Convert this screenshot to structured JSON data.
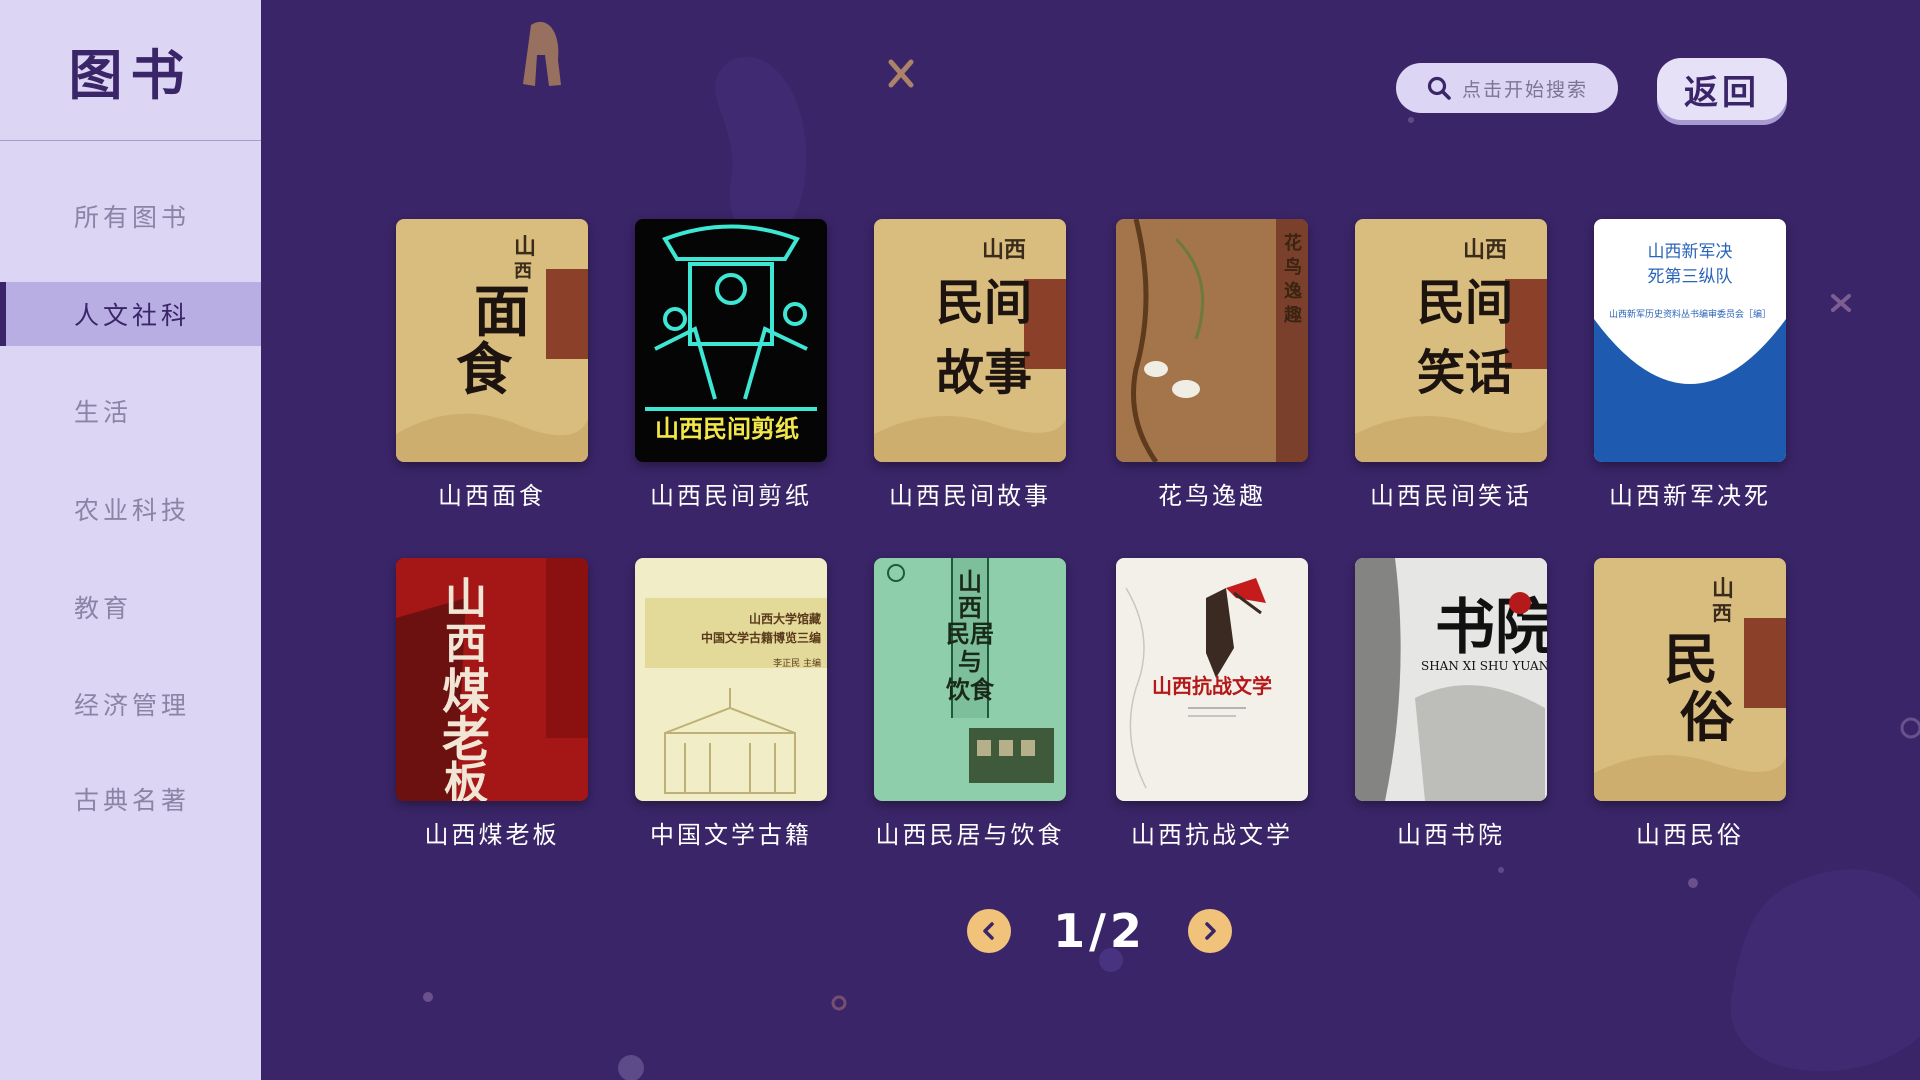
{
  "sidebar": {
    "title": "图书",
    "items": [
      {
        "label": "所有图书"
      },
      {
        "label": "人文社科"
      },
      {
        "label": "生活"
      },
      {
        "label": "农业科技"
      },
      {
        "label": "教育"
      },
      {
        "label": "经济管理"
      },
      {
        "label": "古典名著"
      }
    ],
    "active_index": 1
  },
  "header": {
    "search_placeholder": "点击开始搜索",
    "back_label": "返回"
  },
  "books": [
    {
      "title": "山西面食",
      "cover": {
        "bg": "#d9bd7f",
        "text": "山西面食"
      }
    },
    {
      "title": "山西民间剪纸",
      "cover": {
        "bg": "#050505",
        "text": "山西民间剪纸"
      }
    },
    {
      "title": "山西民间故事",
      "cover": {
        "bg": "#d9bd7f",
        "text": "山西民间故事"
      }
    },
    {
      "title": "花鸟逸趣",
      "cover": {
        "bg": "#9a6a40",
        "text": "花鸟逸趣"
      }
    },
    {
      "title": "山西民间笑话",
      "cover": {
        "bg": "#d9bd7f",
        "text": "山西民间笑话"
      }
    },
    {
      "title": "山西新军决死",
      "cover": {
        "bg": "#ffffff",
        "text": "山西新军决死第三纵队",
        "subtext": "山西新军历史资料丛书编审委员会［编］"
      }
    },
    {
      "title": "山西煤老板",
      "cover": {
        "bg": "#b41a1a",
        "text": "山西煤老板"
      }
    },
    {
      "title": "中国文学古籍",
      "cover": {
        "bg": "#f1edc6",
        "text": "山西大学馆藏 中国文学古籍博览三编",
        "subtext": "李正民 主编"
      }
    },
    {
      "title": "山西民居与饮食",
      "cover": {
        "bg": "#8fceaa",
        "text": "山西民居与饮食"
      }
    },
    {
      "title": "山西抗战文学",
      "cover": {
        "bg": "#f3f0ea",
        "text": "山西抗战文学"
      }
    },
    {
      "title": "山西书院",
      "cover": {
        "bg": "#e8e8e8",
        "text": "书院",
        "subtext": "SHAN XI SHU YUAN"
      }
    },
    {
      "title": "山西民俗",
      "cover": {
        "bg": "#d9bd7f",
        "text": "山西民俗"
      }
    }
  ],
  "pager": {
    "current": "1",
    "separator": "/",
    "total": "2"
  },
  "colors": {
    "background": "#3a2568",
    "sidebar": "#dcd5f3",
    "accent": "#f0c27a"
  },
  "icons": {
    "search": "search-icon",
    "prev": "chevron-left-icon",
    "next": "chevron-right-icon"
  }
}
